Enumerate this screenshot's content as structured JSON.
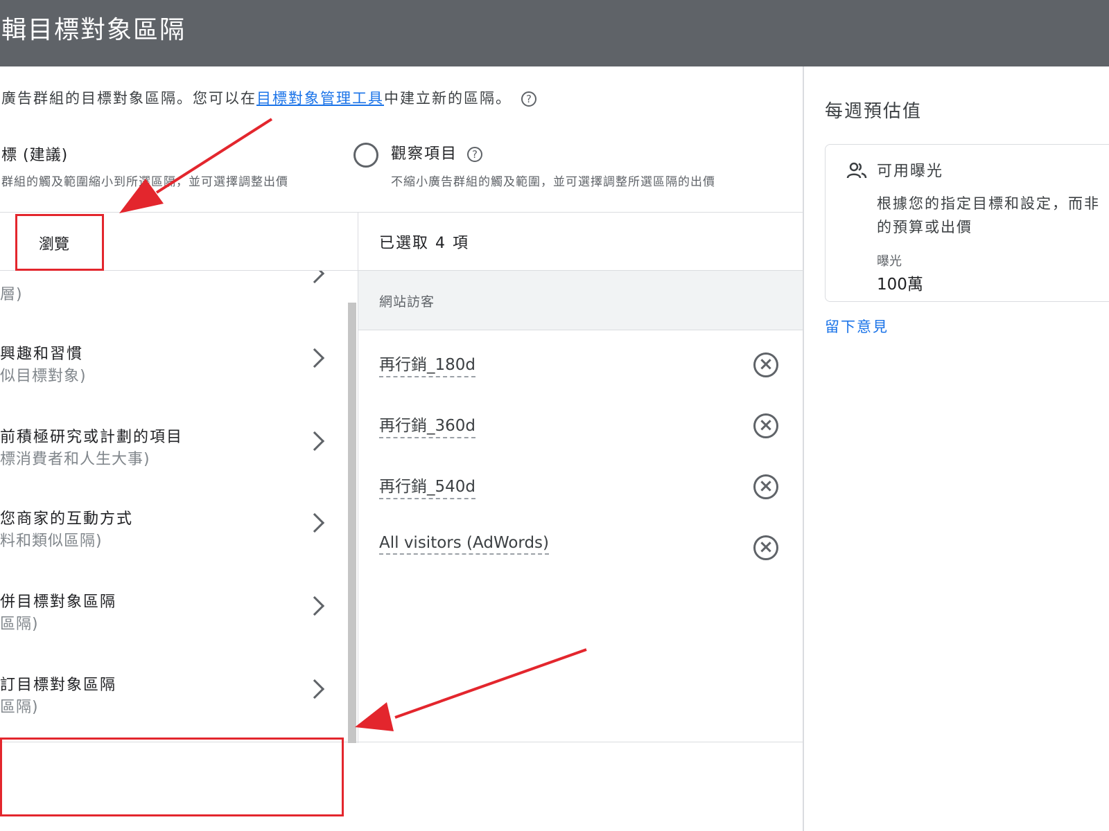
{
  "header": {
    "title": "輯目標對象區隔"
  },
  "description": {
    "prefix": "廣告群組的目標對象區隔。您可以在",
    "link": "目標對象管理工具",
    "suffix": "中建立新的區隔。",
    "help_icon": "?"
  },
  "targeting_options": {
    "option1": {
      "title": "標 (建議)",
      "subtitle": "群組的觸及範圍縮小到所選區隔，並可選擇調整出價"
    },
    "option2": {
      "title": "觀察項目",
      "help_icon": "?",
      "subtitle": "不縮小廣告群組的觸及範圍，並可選擇調整所選區隔的出價"
    }
  },
  "browse": {
    "tab_label": "瀏覽",
    "items": [
      {
        "title": "",
        "subtitle": "層)"
      },
      {
        "title": "興趣和習慣",
        "subtitle": "似目標對象)"
      },
      {
        "title": "前積極研究或計劃的項目",
        "subtitle": "標消費者和人生大事)"
      },
      {
        "title": "您商家的互動方式",
        "subtitle": "料和類似區隔)"
      },
      {
        "title": "併目標對象區隔",
        "subtitle": "區隔)"
      },
      {
        "title": "訂目標對象區隔",
        "subtitle": "區隔)"
      }
    ]
  },
  "selected": {
    "count_label": "已選取 4 項",
    "group_label": "網站訪客",
    "remove_icon": "×",
    "items": [
      {
        "label": "再行銷_180d"
      },
      {
        "label": "再行銷_360d"
      },
      {
        "label": "再行銷_540d"
      },
      {
        "label": "All visitors (AdWords)"
      }
    ]
  },
  "estimates": {
    "title": "每週預估值",
    "card_title": "可用曝光",
    "card_desc_line1": "根據您的指定目標和設定，而非",
    "card_desc_line2": "的預算或出價",
    "metric_label": "曝光",
    "metric_value": "100萬",
    "feedback_link": "留下意見"
  },
  "colors": {
    "header_bg": "#5f6368",
    "link": "#1a73e8",
    "annotation": "#e3262d"
  }
}
